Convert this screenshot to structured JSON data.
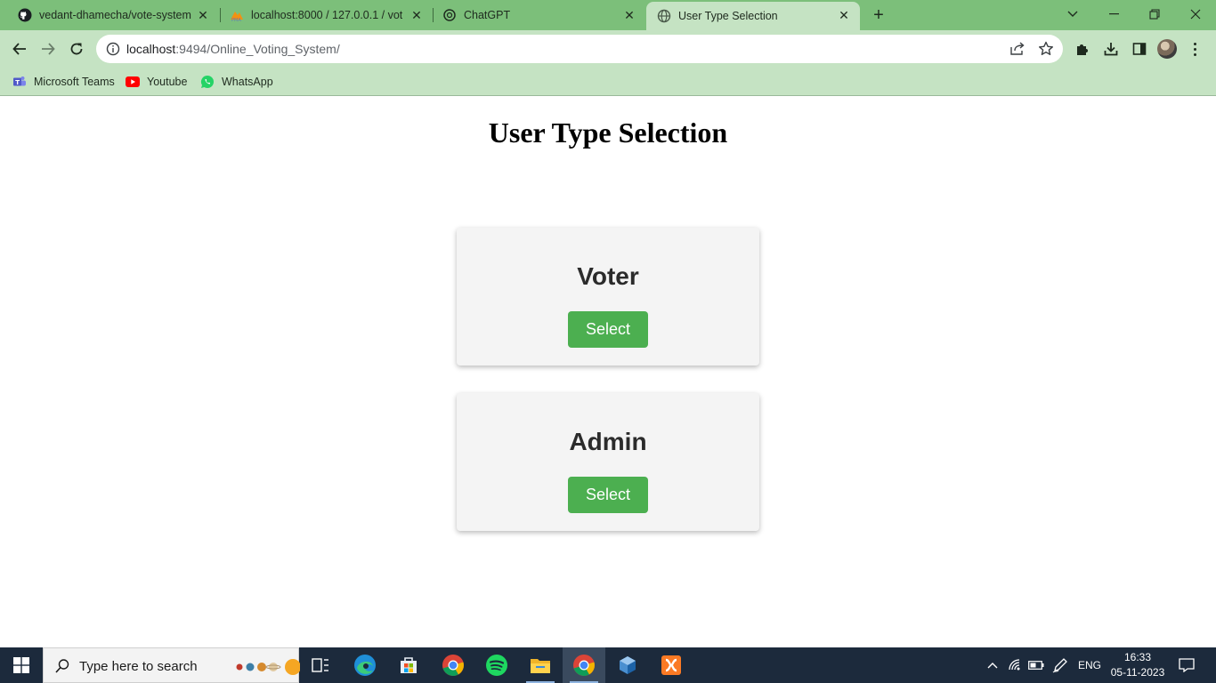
{
  "browser": {
    "tabs": [
      {
        "title": "vedant-dhamecha/vote-system",
        "icon": "github-icon",
        "active": false
      },
      {
        "title": "localhost:8000 / 127.0.0.1 / vote",
        "icon": "phpmyadmin-icon",
        "active": false
      },
      {
        "title": "ChatGPT",
        "icon": "chatgpt-icon",
        "active": false
      },
      {
        "title": "User Type Selection",
        "icon": "globe-icon",
        "active": true
      }
    ],
    "url_host": "localhost",
    "url_rest": ":9494/Online_Voting_System/",
    "bookmarks": [
      {
        "label": "Microsoft Teams",
        "icon": "teams-icon"
      },
      {
        "label": "Youtube",
        "icon": "youtube-icon"
      },
      {
        "label": "WhatsApp",
        "icon": "whatsapp-icon"
      }
    ]
  },
  "page": {
    "title": "User Type Selection",
    "cards": [
      {
        "title": "Voter",
        "button_label": "Select"
      },
      {
        "title": "Admin",
        "button_label": "Select"
      }
    ]
  },
  "taskbar": {
    "search_placeholder": "Type here to search",
    "apps": [
      "task-view",
      "edge",
      "microsoft-store",
      "chrome",
      "spotify",
      "file-explorer",
      "chrome",
      "virtualbox",
      "xampp"
    ],
    "language": "ENG",
    "time": "16:33",
    "date": "05-11-2023"
  },
  "colors": {
    "tab_strip": "#7cbf7a",
    "toolbar": "#c5e3c3",
    "select_button": "#4caf50",
    "card_background": "#f4f4f4",
    "taskbar": "#1c2a3c"
  }
}
